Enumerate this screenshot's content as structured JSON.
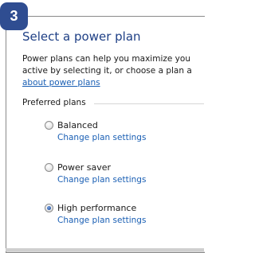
{
  "badge": {
    "number": "3"
  },
  "page": {
    "title": "Select a power plan",
    "description_line1": "Power plans can help you maximize you",
    "description_line2": "active by selecting it, or choose a plan a",
    "about_link": "about power plans"
  },
  "group": {
    "label": "Preferred plans"
  },
  "plans": [
    {
      "name": "Balanced",
      "link": "Change plan settings",
      "selected": false
    },
    {
      "name": "Power saver",
      "link": "Change plan settings",
      "selected": false
    },
    {
      "name": "High performance",
      "link": "Change plan settings",
      "selected": true
    }
  ],
  "colors": {
    "badge": "#2f4d91",
    "title": "#1e3f85",
    "link": "#1a5fb4"
  }
}
